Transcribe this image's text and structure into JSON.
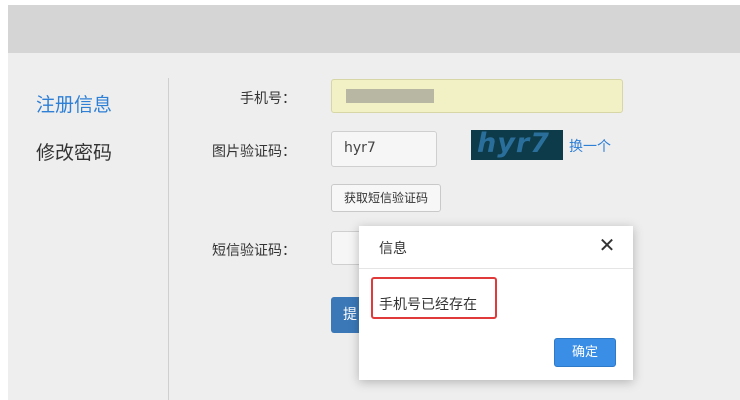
{
  "nav": {
    "register_label": "注册信息",
    "password_label": "修改密码"
  },
  "form": {
    "phone_label": "手机号：",
    "captcha_label": "图片验证码：",
    "captcha_value": "hyr7",
    "captcha_image_text": "hyr7",
    "change_link": "换一个",
    "sms_button": "获取短信验证码",
    "sms_label": "短信验证码：",
    "submit_partial": "提"
  },
  "dialog": {
    "title": "信息",
    "close_glyph": "✕",
    "message": "手机号已经存在",
    "ok_label": "确定"
  },
  "colors": {
    "accent": "#2e7fd6",
    "highlight_border": "#e03a3a",
    "primary_button": "#3a8ee6"
  }
}
